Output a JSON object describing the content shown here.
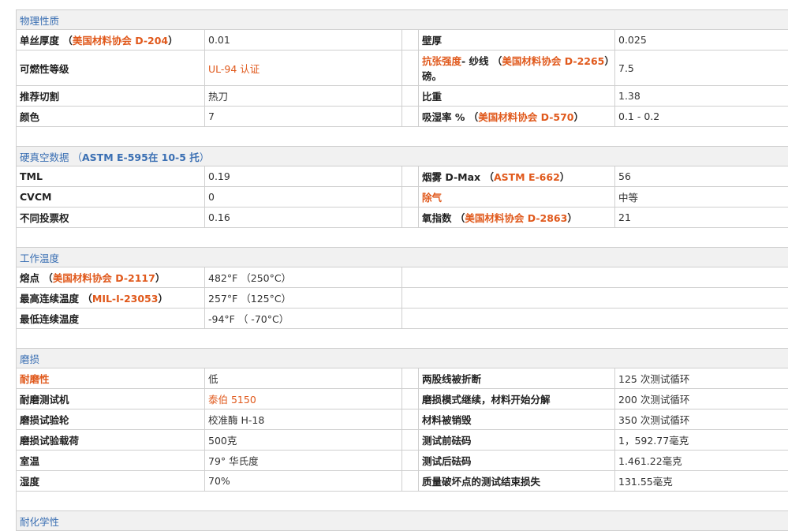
{
  "sections": {
    "physical": {
      "title": "物理性质",
      "rows": [
        {
          "l1": "单丝厚度",
          "r1": "美国材料协会 D-204",
          "v1": "0.01",
          "l2": "壁厚",
          "v2": "0.025"
        },
        {
          "l1": "可燃性等级",
          "v1": "UL-94 认证",
          "l2a": "抗张强度",
          "l2b": "- 纱线",
          "r2": "美国材料协会 D-2265",
          "l2c": "磅。",
          "v2": "7.5"
        },
        {
          "l1": "推荐切割",
          "v1": "热刀",
          "l2": "比重",
          "v2": "1.38"
        },
        {
          "l1": "颜色",
          "v1": "7",
          "l2": "吸湿率 %",
          "r2": "美国材料协会 D-570",
          "v2": "0.1 - 0.2"
        }
      ]
    },
    "vacuum": {
      "title": "硬真空数据",
      "ref": "ASTM E-595在 10-5 托",
      "rows": [
        {
          "l1": "TML",
          "v1": "0.19",
          "l2": "烟雾 D-Max",
          "r2": "ASTM E-662",
          "v2": "56"
        },
        {
          "l1": "CVCM",
          "v1": "0",
          "l2": "除气",
          "v2": "中等"
        },
        {
          "l1": "不同投票权",
          "v1": "0.16",
          "l2": "氧指数",
          "r2": "美国材料协会 D-2863",
          "v2": "21"
        }
      ]
    },
    "temperature": {
      "title": "工作温度",
      "rows": [
        {
          "l1": "熔点",
          "r1": "美国材料协会 D-2117",
          "v1": "482°F （250°C）"
        },
        {
          "l1": "最高连续温度",
          "r1": "MIL-I-23053",
          "v1": "257°F （125°C）"
        },
        {
          "l1": "最低连续温度",
          "v1": "-94°F （ -70°C）"
        }
      ]
    },
    "abrasion": {
      "title": "磨损",
      "rows": [
        {
          "l1": "耐磨性",
          "v1": "低",
          "l2": "两股线被折断",
          "v2": "125 次测试循环"
        },
        {
          "l1": "耐磨测试机",
          "v1": "泰伯 5150",
          "l2": "磨损模式继续，材料开始分解",
          "v2": "200 次测试循环"
        },
        {
          "l1": "磨损试验轮",
          "v1": "校准酶 H-18",
          "l2": "材料被销毁",
          "v2": "350 次测试循环"
        },
        {
          "l1": "磨损试验载荷",
          "v1": "500克",
          "l2": "测试前砝码",
          "v2": "1，592.77毫克"
        },
        {
          "l1": "室温",
          "v1": "79° 华氏度",
          "l2": "测试后砝码",
          "v2": "1.461.22毫克"
        },
        {
          "l1": "湿度",
          "v1": "70%",
          "l2": "质量破坏点的测试结束损失",
          "v2": "131.55毫克"
        }
      ]
    },
    "next": {
      "title": "耐化学性"
    }
  }
}
